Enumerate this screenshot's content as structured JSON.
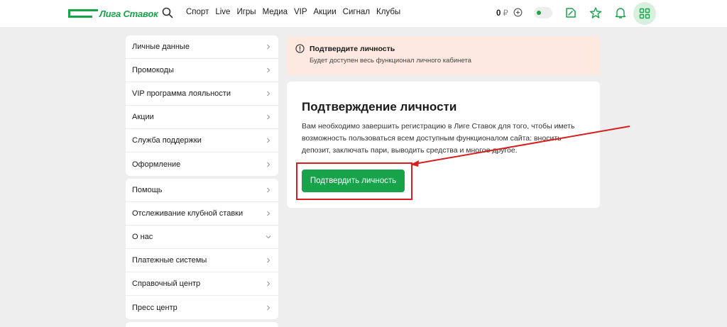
{
  "header": {
    "logo_text": "Лига Ставок",
    "nav": [
      "Спорт",
      "Live",
      "Игры",
      "Медиа",
      "VIP",
      "Акции",
      "Сигнал",
      "Клубы"
    ],
    "balance_value": "0",
    "balance_currency": "₽"
  },
  "sidebar": {
    "group1": [
      "Личные данные",
      "Промокоды",
      "VIP программа лояльности",
      "Акции",
      "Служба поддержки",
      "Оформление"
    ],
    "group2": [
      "Помощь",
      "Отслеживание клубной ставки",
      "О нас",
      "Платежные системы",
      "Справочный центр",
      "Пресс центр"
    ]
  },
  "alert": {
    "title": "Подтвердите личность",
    "subtitle": "Будет доступен весь функционал личного кабинета"
  },
  "main": {
    "title": "Подтверждение личности",
    "text": "Вам необходимо завершить регистрацию в Лиге Ставок для того, чтобы иметь возможность пользоваться всем доступным функционалом сайта: вносить депозит, заключать пари, выводить средства и многое другое.",
    "button_label": "Подтвердить личность"
  },
  "colors": {
    "accent": "#16a34a",
    "alert_bg": "#fde9df",
    "annotation": "#d61f1f"
  }
}
